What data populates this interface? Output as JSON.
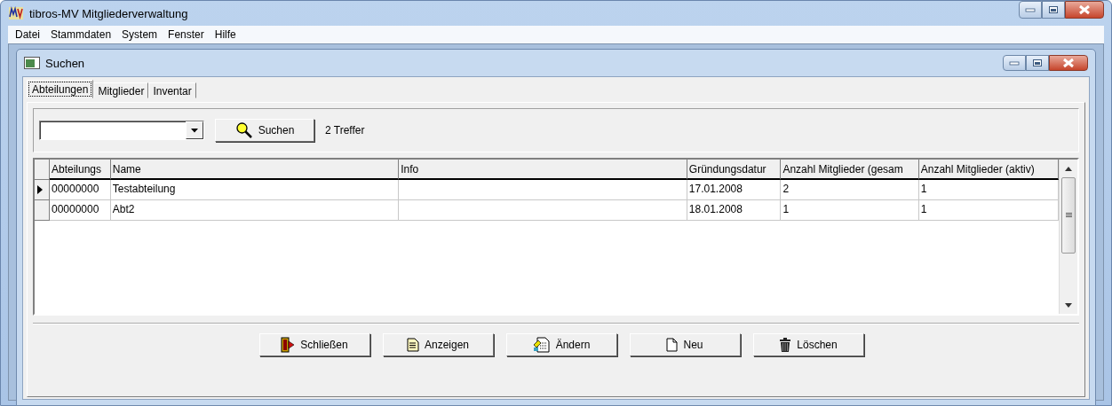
{
  "window": {
    "title": "tibros-MV Mitgliederverwaltung"
  },
  "menu": [
    "Datei",
    "Stammdaten",
    "System",
    "Fenster",
    "Hilfe"
  ],
  "child_window": {
    "title": "Suchen"
  },
  "tabs": [
    {
      "label": "Abteilungen",
      "selected": true
    },
    {
      "label": "Mitglieder",
      "selected": false
    },
    {
      "label": "Inventar",
      "selected": false
    }
  ],
  "search": {
    "button": {
      "label": "Suchen"
    },
    "result_count": "2 Treffer"
  },
  "table": {
    "columns": [
      "Abteilungs",
      "Name",
      "Info",
      "Gründungsdatur",
      "Anzahl Mitglieder (gesam",
      "Anzahl Mitglieder (aktiv)"
    ],
    "rows": [
      {
        "current": true,
        "cells": [
          "00000000",
          "Testabteilung",
          "",
          "17.01.2008",
          "2",
          "1"
        ]
      },
      {
        "current": false,
        "cells": [
          "00000000",
          "Abt2",
          "",
          "18.01.2008",
          "1",
          "1"
        ]
      }
    ]
  },
  "buttons": [
    {
      "kind": "exit",
      "label": "Schließen"
    },
    {
      "kind": "view",
      "label": "Anzeigen"
    },
    {
      "kind": "edit",
      "label": "Ändern"
    },
    {
      "kind": "new",
      "label": "Neu"
    },
    {
      "kind": "delete",
      "label": "Löschen"
    }
  ]
}
